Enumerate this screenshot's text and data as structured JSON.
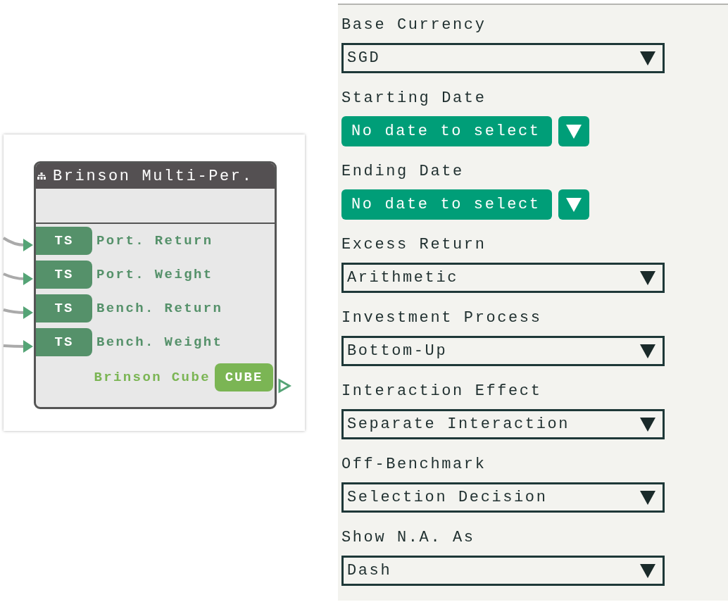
{
  "node": {
    "title": "Brinson Multi-Per.",
    "inputs": [
      {
        "type": "TS",
        "label": "Port. Return"
      },
      {
        "type": "TS",
        "label": "Port. Weight"
      },
      {
        "type": "TS",
        "label": "Bench. Return"
      },
      {
        "type": "TS",
        "label": "Bench. Weight"
      }
    ],
    "output": {
      "label": "Brinson Cube",
      "type": "CUBE"
    }
  },
  "panel": {
    "fields": [
      {
        "kind": "select",
        "label": "Base Currency",
        "value": "SGD"
      },
      {
        "kind": "date",
        "label": "Starting Date",
        "value": "No date to select"
      },
      {
        "kind": "date",
        "label": "Ending Date",
        "value": "No date to select"
      },
      {
        "kind": "select",
        "label": "Excess Return",
        "value": "Arithmetic"
      },
      {
        "kind": "select",
        "label": "Investment Process",
        "value": "Bottom-Up"
      },
      {
        "kind": "select",
        "label": "Interaction Effect",
        "value": "Separate Interaction"
      },
      {
        "kind": "select",
        "label": "Off-Benchmark",
        "value": "Selection Decision"
      },
      {
        "kind": "select",
        "label": "Show N.A. As",
        "value": "Dash"
      }
    ]
  }
}
